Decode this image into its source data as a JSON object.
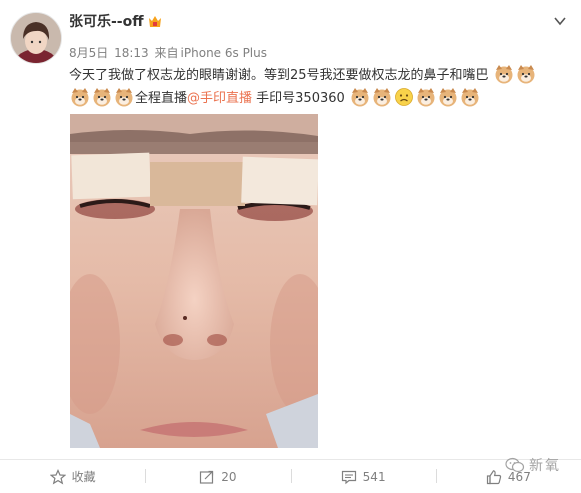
{
  "user": {
    "name": "张可乐--off"
  },
  "meta": {
    "date": "8月5日",
    "time": "18:13",
    "source_prefix": "来自",
    "device": "iPhone 6s Plus"
  },
  "content": {
    "line1_text": "今天了我做了权志龙的眼睛谢谢。等到25号我还要做权志龙的鼻子和嘴巴",
    "line2_text_a": "全程直播",
    "mention": "@手印直播",
    "line2_text_b": " 手印号350360"
  },
  "actions": {
    "favorite_label": "收藏",
    "repost_count": "20",
    "comment_count": "541",
    "like_count": "467"
  },
  "watermark": {
    "text": "新氧"
  },
  "colors": {
    "mention": "#eb7350",
    "meta_gray": "#808080"
  }
}
